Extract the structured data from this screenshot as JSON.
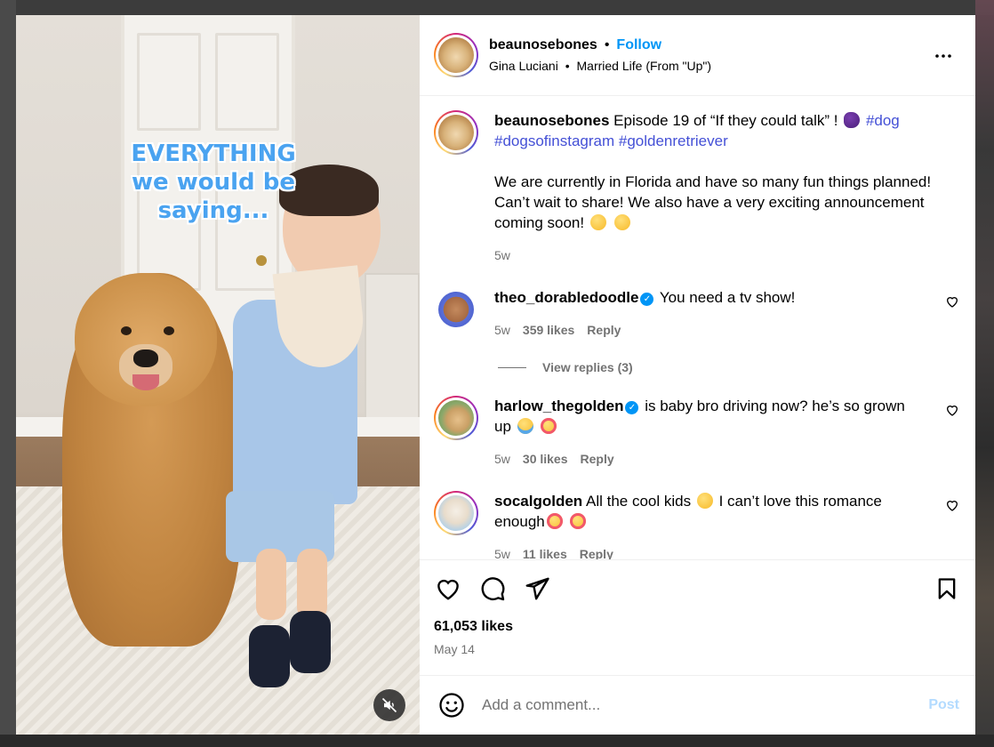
{
  "media": {
    "overlay_text": "EVERYTHING we would be saying...",
    "mute_icon": "speaker-muted-icon"
  },
  "header": {
    "username": "beaunosebones",
    "separator": "•",
    "follow_label": "Follow",
    "subtitle_author": "Gina Luciani",
    "subtitle_separator": "•",
    "subtitle_audio": "Married Life (From \"Up\")",
    "more_icon": "more-horizontal-icon"
  },
  "caption": {
    "username": "beaunosebones",
    "text": "Episode 19 of “If they could talk” !",
    "hashtag1": "#dog",
    "hashtag2": "#dogsofinstagram",
    "hashtag3": "#goldenretriever",
    "body": "We are currently in Florida and have so many fun things planned! Can’t wait to share! We also have a very exciting announcement coming soon!",
    "time": "5w"
  },
  "comments": [
    {
      "username": "theo_dorabledoodle",
      "verified": true,
      "text": "You need a tv show!",
      "time": "5w",
      "likes": "359 likes",
      "reply": "Reply",
      "view_replies": "View replies (3)"
    },
    {
      "username": "harlow_thegolden",
      "verified": true,
      "text": "is baby bro driving now? he’s so grown up",
      "time": "5w",
      "likes": "30 likes",
      "reply": "Reply"
    },
    {
      "username": "socalgolden",
      "verified": false,
      "text_before": "All the cool kids",
      "text_after": "I can’t love this romance enough",
      "time": "5w",
      "likes": "11 likes",
      "reply": "Reply"
    }
  ],
  "actions": {
    "like_icon": "heart-icon",
    "comment_icon": "comment-bubble-icon",
    "share_icon": "paper-plane-icon",
    "save_icon": "bookmark-icon",
    "likes": "61,053 likes",
    "date": "May 14"
  },
  "comment_box": {
    "emoji_icon": "smiley-face-icon",
    "placeholder": "Add a comment...",
    "post_label": "Post"
  },
  "colors": {
    "link_blue": "#0095f6",
    "hashtag": "#4450d6",
    "muted_text": "#737373",
    "post_disabled": "#b3dbff"
  }
}
